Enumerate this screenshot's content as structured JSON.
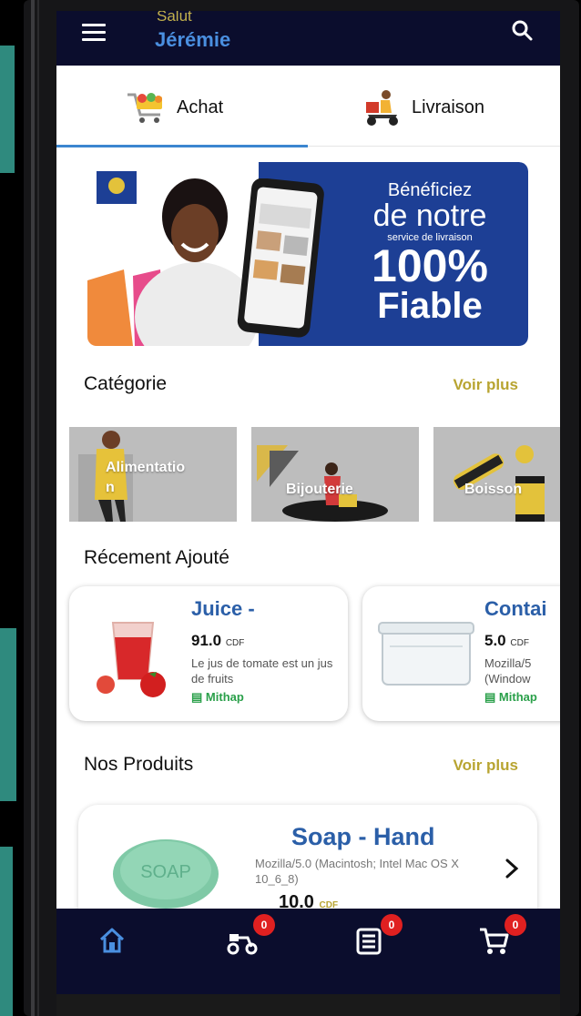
{
  "header": {
    "greeting": "Salut",
    "username": "Jérémie",
    "menu_icon": "menu-icon",
    "search_icon": "search-icon",
    "background": "#0b0d2d"
  },
  "tabs": [
    {
      "label": "Achat",
      "icon": "shopping-cart-icon",
      "active": true
    },
    {
      "label": "Livraison",
      "icon": "delivery-scooter-icon",
      "active": false
    }
  ],
  "banner": {
    "line1": "Bénéficiez",
    "line2": "de notre",
    "line3": "service de livraison",
    "line4": "100%",
    "line5": "Fiable"
  },
  "categories_section": {
    "title": "Catégorie",
    "more": "Voir plus",
    "items": [
      {
        "label": "Alimentatio\nn"
      },
      {
        "label": "Bijouterie"
      },
      {
        "label": "Boisson"
      }
    ]
  },
  "recent_section": {
    "title": "Récement Ajouté",
    "items": [
      {
        "title": "Juice -",
        "price": "91.0",
        "currency": "CDF",
        "description": "Le jus de tomate est un jus de fruits",
        "shop": "Mithap"
      },
      {
        "title": "Contai",
        "price": "5.0",
        "currency": "CDF",
        "description": "Mozilla/5 (Window",
        "shop": "Mithap"
      }
    ]
  },
  "products_section": {
    "title": "Nos Produits",
    "more": "Voir plus",
    "items": [
      {
        "title": "Soap - Hand",
        "description": "Mozilla/5.0 (Macintosh; Intel Mac OS X 10_6_8)",
        "price": "10.0",
        "currency": "CDF"
      }
    ]
  },
  "bottom_nav": [
    {
      "icon": "home-icon",
      "badge": ""
    },
    {
      "icon": "delivery-scooter-icon",
      "badge": "0"
    },
    {
      "icon": "order-list-icon",
      "badge": "0"
    },
    {
      "icon": "cart-icon",
      "badge": "0"
    }
  ],
  "colors": {
    "accent_blue": "#3b86d0",
    "gold": "#b8a431",
    "shop_green": "#2aa04a",
    "badge_red": "#e02020"
  }
}
